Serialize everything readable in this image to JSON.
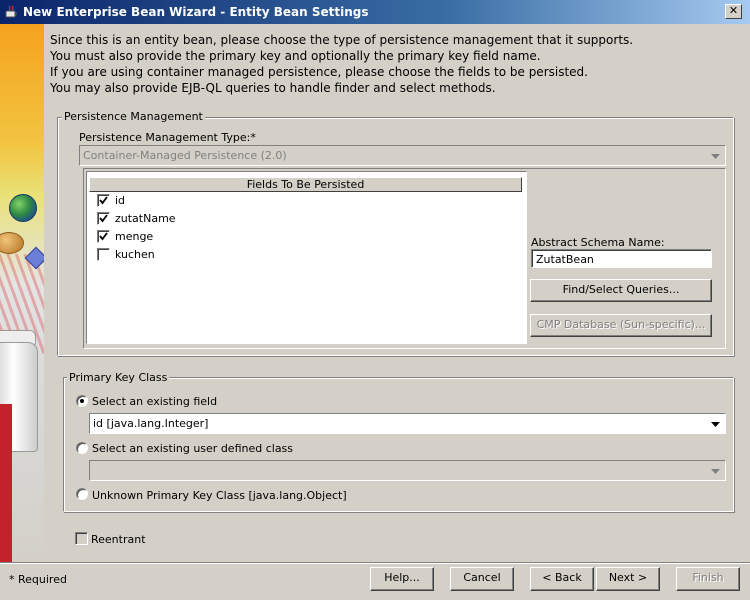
{
  "window": {
    "title": "New Enterprise Bean Wizard - Entity Bean Settings",
    "close_label": "✕"
  },
  "intro": {
    "lines": [
      "Since this is an entity bean, please choose the type of persistence management that it supports.",
      "You must also provide the primary key and optionally the primary key field name.",
      "If you are using container managed persistence, please choose the fields to be persisted.",
      "You may also provide EJB-QL queries to handle finder and select methods."
    ]
  },
  "persistence": {
    "group_label": "Persistence Management",
    "type_label": "Persistence Management Type:*",
    "type_value": "Container-Managed Persistence (2.0)",
    "fields_header": "Fields To Be Persisted",
    "fields": [
      {
        "name": "id",
        "checked": true
      },
      {
        "name": "zutatName",
        "checked": true
      },
      {
        "name": "menge",
        "checked": true
      },
      {
        "name": "kuchen",
        "checked": false
      }
    ],
    "abstract_schema_label": "Abstract Schema Name:",
    "abstract_schema_value": "ZutatBean",
    "find_select_button": "Find/Select Queries...",
    "cmp_database_button": "CMP Database (Sun-specific)..."
  },
  "primary_key": {
    "group_label": "Primary Key Class",
    "option_existing_field": "Select an existing field",
    "existing_field_value": "id  [java.lang.Integer]",
    "option_user_class": "Select an existing user defined class",
    "user_class_value": "",
    "option_unknown": "Unknown Primary Key Class [java.lang.Object]",
    "selected_option": "existing_field"
  },
  "reentrant": {
    "label": "Reentrant",
    "checked": false
  },
  "footer": {
    "required_note": "* Required",
    "help": "Help...",
    "cancel": "Cancel",
    "back": "< Back",
    "next": "Next >",
    "finish": "Finish"
  },
  "colors": {
    "titlebar_start": "#0a246a",
    "titlebar_end": "#a6caf0",
    "window_bg": "#d4d0c8",
    "disabled_text": "#808080"
  },
  "icons": {
    "app": "java-cup-icon",
    "close": "close-icon",
    "dropdown": "chevron-down-icon",
    "check": "check-icon"
  }
}
